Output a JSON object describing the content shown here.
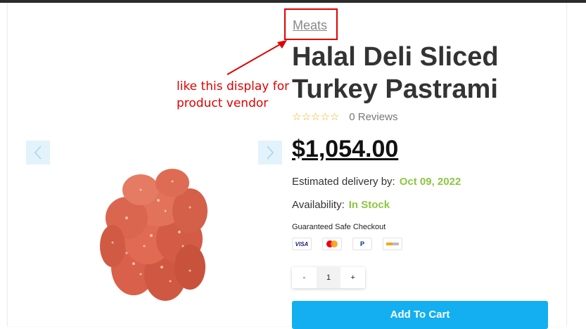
{
  "vendor": {
    "label": "Meats"
  },
  "annotation": {
    "line1": "like this display for",
    "line2": "product vendor"
  },
  "product": {
    "title_line1": "Halal Deli Sliced",
    "title_line2": "Turkey Pastrami",
    "rating_stars": "☆☆☆☆☆",
    "rating_value": 0,
    "reviews_label": "0 Reviews",
    "price": "$1,054.00"
  },
  "delivery": {
    "label": "Estimated delivery by:",
    "date": "Oct 09, 2022"
  },
  "availability": {
    "label": "Availability:",
    "status": "In Stock"
  },
  "checkout": {
    "label": "Guaranteed Safe Checkout",
    "methods": [
      "VISA",
      "mastercard",
      "P",
      "discover"
    ]
  },
  "quantity": {
    "minus": "-",
    "value": "1",
    "plus": "+"
  },
  "cart": {
    "button_label": "Add To Cart"
  },
  "colors": {
    "accent": "#13aff0",
    "annotation": "#e00000",
    "stock_green": "#8dc63f",
    "star": "#f2b01e"
  },
  "icons": {
    "prev": "chevron-left-icon",
    "next": "chevron-right-icon"
  }
}
